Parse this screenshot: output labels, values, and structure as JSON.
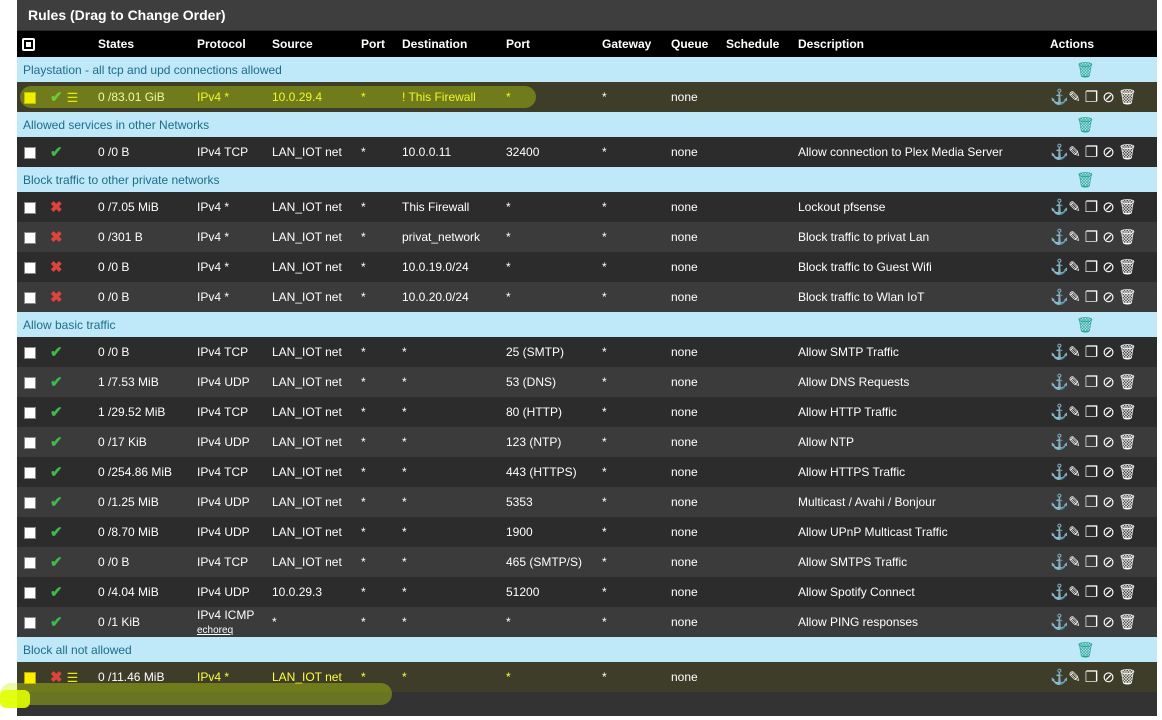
{
  "panel": {
    "title": "Rules (Drag to Change Order)"
  },
  "headers": {
    "states": "States",
    "protocol": "Protocol",
    "source": "Source",
    "port": "Port",
    "destination": "Destination",
    "dport": "Port",
    "gateway": "Gateway",
    "queue": "Queue",
    "schedule": "Schedule",
    "description": "Description",
    "actions": "Actions"
  },
  "separators": [
    "Playstation - all tcp and upd connections allowed",
    "Allowed services in other Networks",
    "Block traffic to other private networks",
    "Allow basic traffic",
    "Block all not allowed"
  ],
  "rules": [
    {
      "status": "pass",
      "states": "0 /83.01 GiB",
      "protocol": "IPv4 *",
      "source": "10.0.29.4",
      "port": "*",
      "destination": "! This Firewall",
      "dport": "*",
      "gateway": "*",
      "queue": "none",
      "description": ""
    },
    {
      "status": "pass",
      "states": "0 /0 B",
      "protocol": "IPv4 TCP",
      "source": "LAN_IOT net",
      "port": "*",
      "destination": "10.0.0.11",
      "dport": "32400",
      "gateway": "*",
      "queue": "none",
      "description": "Allow connection to Plex Media Server"
    },
    {
      "status": "block",
      "states": "0 /7.05 MiB",
      "protocol": "IPv4 *",
      "source": "LAN_IOT net",
      "port": "*",
      "destination": "This Firewall",
      "dport": "*",
      "gateway": "*",
      "queue": "none",
      "description": "Lockout pfsense"
    },
    {
      "status": "block",
      "states": "0 /301 B",
      "protocol": "IPv4 *",
      "source": "LAN_IOT net",
      "port": "*",
      "destination": "privat_network",
      "dport": "*",
      "gateway": "*",
      "queue": "none",
      "description": "Block traffic to privat Lan"
    },
    {
      "status": "block",
      "states": "0 /0 B",
      "protocol": "IPv4 *",
      "source": "LAN_IOT net",
      "port": "*",
      "destination": "10.0.19.0/24",
      "dport": "*",
      "gateway": "*",
      "queue": "none",
      "description": "Block traffic to Guest Wifi"
    },
    {
      "status": "block",
      "states": "0 /0 B",
      "protocol": "IPv4 *",
      "source": "LAN_IOT net",
      "port": "*",
      "destination": "10.0.20.0/24",
      "dport": "*",
      "gateway": "*",
      "queue": "none",
      "description": "Block traffic to Wlan IoT"
    },
    {
      "status": "pass",
      "states": "0 /0 B",
      "protocol": "IPv4 TCP",
      "source": "LAN_IOT net",
      "port": "*",
      "destination": "*",
      "dport": "25 (SMTP)",
      "gateway": "*",
      "queue": "none",
      "description": "Allow SMTP Traffic"
    },
    {
      "status": "pass",
      "states": "1 /7.53 MiB",
      "protocol": "IPv4 UDP",
      "source": "LAN_IOT net",
      "port": "*",
      "destination": "*",
      "dport": "53 (DNS)",
      "gateway": "*",
      "queue": "none",
      "description": "Allow DNS Requests"
    },
    {
      "status": "pass",
      "states": "1 /29.52 MiB",
      "protocol": "IPv4 TCP",
      "source": "LAN_IOT net",
      "port": "*",
      "destination": "*",
      "dport": "80 (HTTP)",
      "gateway": "*",
      "queue": "none",
      "description": "Allow HTTP Traffic"
    },
    {
      "status": "pass",
      "states": "0 /17 KiB",
      "protocol": "IPv4 UDP",
      "source": "LAN_IOT net",
      "port": "*",
      "destination": "*",
      "dport": "123 (NTP)",
      "gateway": "*",
      "queue": "none",
      "description": "Allow NTP"
    },
    {
      "status": "pass",
      "states": "0 /254.86 MiB",
      "protocol": "IPv4 TCP",
      "source": "LAN_IOT net",
      "port": "*",
      "destination": "*",
      "dport": "443 (HTTPS)",
      "gateway": "*",
      "queue": "none",
      "description": "Allow HTTPS Traffic"
    },
    {
      "status": "pass",
      "states": "0 /1.25 MiB",
      "protocol": "IPv4 UDP",
      "source": "LAN_IOT net",
      "port": "*",
      "destination": "*",
      "dport": "5353",
      "gateway": "*",
      "queue": "none",
      "description": "Multicast / Avahi / Bonjour"
    },
    {
      "status": "pass",
      "states": "0 /8.70 MiB",
      "protocol": "IPv4 UDP",
      "source": "LAN_IOT net",
      "port": "*",
      "destination": "*",
      "dport": "1900",
      "gateway": "*",
      "queue": "none",
      "description": "Allow UPnP Multicast Traffic"
    },
    {
      "status": "pass",
      "states": "0 /0 B",
      "protocol": "IPv4 TCP",
      "source": "LAN_IOT net",
      "port": "*",
      "destination": "*",
      "dport": "465 (SMTP/S)",
      "gateway": "*",
      "queue": "none",
      "description": "Allow SMTPS Traffic"
    },
    {
      "status": "pass",
      "states": "0 /4.04 MiB",
      "protocol": "IPv4 UDP",
      "source": "10.0.29.3",
      "port": "*",
      "destination": "*",
      "dport": "51200",
      "gateway": "*",
      "queue": "none",
      "description": "Allow Spotify Connect"
    },
    {
      "status": "pass",
      "states": "0 /1 KiB",
      "protocol": "IPv4 ICMP",
      "protocol_sub": "echoreq",
      "source": "*",
      "port": "*",
      "destination": "*",
      "dport": "*",
      "gateway": "*",
      "queue": "none",
      "description": "Allow PING responses"
    },
    {
      "status": "block",
      "states": "0 /11.46 MiB",
      "protocol": "IPv4 *",
      "source": "LAN_IOT net",
      "port": "*",
      "destination": "*",
      "dport": "*",
      "gateway": "*",
      "queue": "none",
      "description": ""
    }
  ],
  "colors": {
    "accent": "#1fa38c",
    "separator_bg": "#bfe8f9",
    "pass": "#3dba4c",
    "block": "#e0433b",
    "highlight": "#ffff3a"
  }
}
